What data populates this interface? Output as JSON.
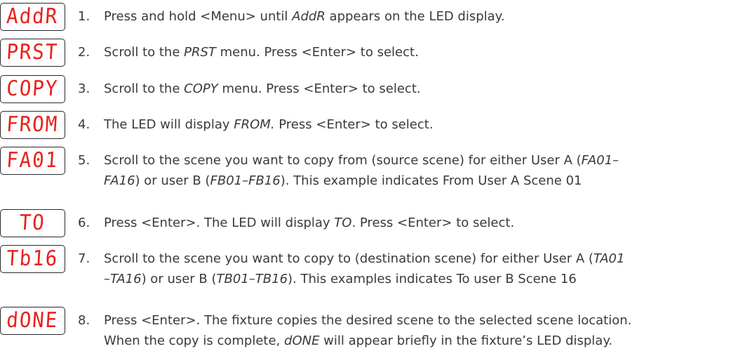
{
  "steps": [
    {
      "led": "AddR",
      "number": "1.",
      "lines": [
        [
          {
            "t": "Press and hold <Menu> until "
          },
          {
            "t": "AddR",
            "i": true
          },
          {
            "t": " appears on the LED display."
          }
        ]
      ]
    },
    {
      "led": "PRST",
      "number": "2.",
      "lines": [
        [
          {
            "t": "Scroll to the "
          },
          {
            "t": "PRST",
            "i": true
          },
          {
            "t": " menu. Press <Enter> to select."
          }
        ]
      ]
    },
    {
      "led": "COPY",
      "number": "3.",
      "lines": [
        [
          {
            "t": "Scroll to the "
          },
          {
            "t": "COPY",
            "i": true
          },
          {
            "t": " menu. Press <Enter> to select."
          }
        ]
      ]
    },
    {
      "led": "FROM",
      "number": "4.",
      "lines": [
        [
          {
            "t": "The LED will display "
          },
          {
            "t": "FROM.",
            "i": true
          },
          {
            "t": " Press <Enter> to select."
          }
        ]
      ]
    },
    {
      "led": "FA01",
      "number": "5.",
      "lines": [
        [
          {
            "t": "Scroll to the scene you want to copy from (source scene) for either User A ("
          },
          {
            "t": "FA01–",
            "i": true
          }
        ],
        [
          {
            "t": "FA16",
            "i": true
          },
          {
            "t": ") or user B ("
          },
          {
            "t": "FB01–FB16",
            "i": true
          },
          {
            "t": "). This example indicates From User A Scene 01"
          }
        ]
      ]
    },
    {
      "led": "TO",
      "number": "6.",
      "lines": [
        [
          {
            "t": "Press <Enter>. The LED will display "
          },
          {
            "t": "TO",
            "i": true
          },
          {
            "t": ". Press <Enter> to select."
          }
        ]
      ]
    },
    {
      "led": "Tb16",
      "number": "7.",
      "lines": [
        [
          {
            "t": "Scroll to the scene you want to copy to (destination scene) for either User A ("
          },
          {
            "t": "TA01",
            "i": true
          }
        ],
        [
          {
            "t": "–TA16",
            "i": true
          },
          {
            "t": ") or user B ("
          },
          {
            "t": "TB01–TB16",
            "i": true
          },
          {
            "t": "). This examples indicates To user B Scene 16"
          }
        ]
      ]
    },
    {
      "led": "dONE",
      "number": "8.",
      "lines": [
        [
          {
            "t": "Press <Enter>. The fixture copies the desired scene to the selected scene location."
          }
        ],
        [
          {
            "t": "When the copy is complete, "
          },
          {
            "t": "dONE",
            "i": true
          },
          {
            "t": " will appear briefly in the fixture’s LED display."
          }
        ]
      ]
    }
  ]
}
